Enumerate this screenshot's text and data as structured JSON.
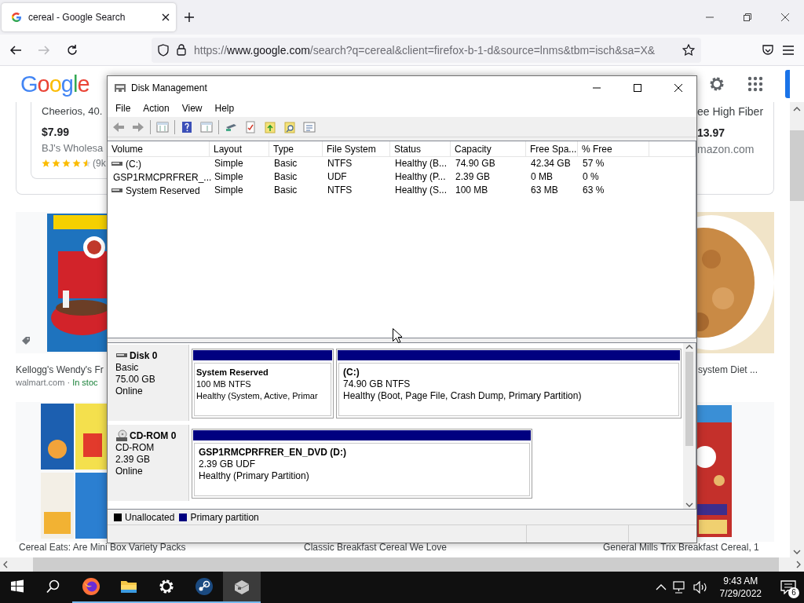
{
  "browser": {
    "tab": {
      "title": "cereal - Google Search",
      "selected": true
    },
    "nav": [
      {
        "kind": "back",
        "disabled": false
      },
      {
        "kind": "forward",
        "disabled": true
      },
      {
        "kind": "reload",
        "disabled": false
      }
    ],
    "url": {
      "scheme": "https://",
      "host": "www.google.com",
      "path": "/search?q=cereal&client=firefox-b-1-d&source=lnms&tbm=isch&sa=X&"
    }
  },
  "google": {
    "logo": "Google",
    "shopping": [
      {
        "title": "Cheerios, 40.",
        "price": "$7.99",
        "store": "BJ's Wholesa",
        "stars": 4.5,
        "reviews": "(9k"
      },
      {
        "title": "ee High Fiber",
        "price": "13.97",
        "store": "mazon.com"
      }
    ],
    "images": [
      {
        "title": "Kellogg's Wendy's Fr",
        "source": "walmart.com ·",
        "stock": "In stoc",
        "tagged": true
      },
      {
        "title": "system Diet ...",
        "tagged": false
      }
    ],
    "captions": [
      "Cereal Eats: Are Mini Box Variety Packs",
      "Classic Breakfast Cereal We Love",
      "General Mills Trix Breakfast Cereal, 1"
    ]
  },
  "disk_management": {
    "title": "Disk Management",
    "menu": [
      "File",
      "Action",
      "View",
      "Help"
    ],
    "toolbar": [
      {
        "kind": "back"
      },
      {
        "kind": "forward"
      },
      {
        "kind": "sep"
      },
      {
        "kind": "pane"
      },
      {
        "kind": "sep"
      },
      {
        "kind": "help"
      },
      {
        "kind": "pane2"
      },
      {
        "kind": "sep"
      },
      {
        "kind": "drive"
      },
      {
        "kind": "check"
      },
      {
        "kind": "upfolder"
      },
      {
        "kind": "findfolder"
      },
      {
        "kind": "list"
      }
    ],
    "table": {
      "columns": [
        "Volume",
        "Layout",
        "Type",
        "File System",
        "Status",
        "Capacity",
        "Free Spa...",
        "% Free"
      ],
      "rows": [
        {
          "kind": "disk",
          "cells": [
            "(C:)",
            "Simple",
            "Basic",
            "NTFS",
            "Healthy (B...",
            "74.90 GB",
            "42.34 GB",
            "57 %"
          ]
        },
        {
          "kind": "cdrom",
          "cells": [
            "GSP1RMCPRFRER_...",
            "Simple",
            "Basic",
            "UDF",
            "Healthy (P...",
            "2.39 GB",
            "0 MB",
            "0 %"
          ]
        },
        {
          "kind": "disk",
          "cells": [
            "System Reserved",
            "Simple",
            "Basic",
            "NTFS",
            "Healthy (S...",
            "100 MB",
            "63 MB",
            "63 %"
          ]
        }
      ]
    },
    "disks": [
      {
        "kind": "disk",
        "name": "Disk 0",
        "type": "Basic",
        "size": "75.00 GB",
        "status": "Online",
        "partitions": [
          {
            "name": "System Reserved",
            "detail": "100 MB NTFS",
            "health": "Healthy (System, Active, Primar"
          },
          {
            "name": "(C:)",
            "detail": "74.90 GB NTFS",
            "health": "Healthy (Boot, Page File, Crash Dump, Primary Partition)"
          }
        ]
      },
      {
        "kind": "cdrom",
        "name": "CD-ROM 0",
        "type": "CD-ROM",
        "size": "2.39 GB",
        "status": "Online",
        "partitions": [
          {
            "name": "GSP1RMCPRFRER_EN_DVD  (D:)",
            "detail": "2.39 GB UDF",
            "health": "Healthy (Primary Partition)"
          }
        ]
      }
    ],
    "legend": [
      {
        "label": "Unallocated",
        "color": "#000000"
      },
      {
        "label": "Primary partition",
        "color": "#000080"
      }
    ]
  },
  "taskbar": {
    "apps": [
      {
        "kind": "start",
        "running": false,
        "selected": false
      },
      {
        "kind": "search",
        "running": false,
        "selected": false
      },
      {
        "kind": "firefox",
        "running": true,
        "selected": false
      },
      {
        "kind": "folder",
        "running": true,
        "selected": false
      },
      {
        "kind": "settings",
        "running": true,
        "selected": false
      },
      {
        "kind": "steam",
        "running": true,
        "selected": false
      },
      {
        "kind": "diskmgmt",
        "running": true,
        "selected": true
      }
    ],
    "time": "9:43 AM",
    "date": "7/29/2022",
    "notifications": "6"
  }
}
